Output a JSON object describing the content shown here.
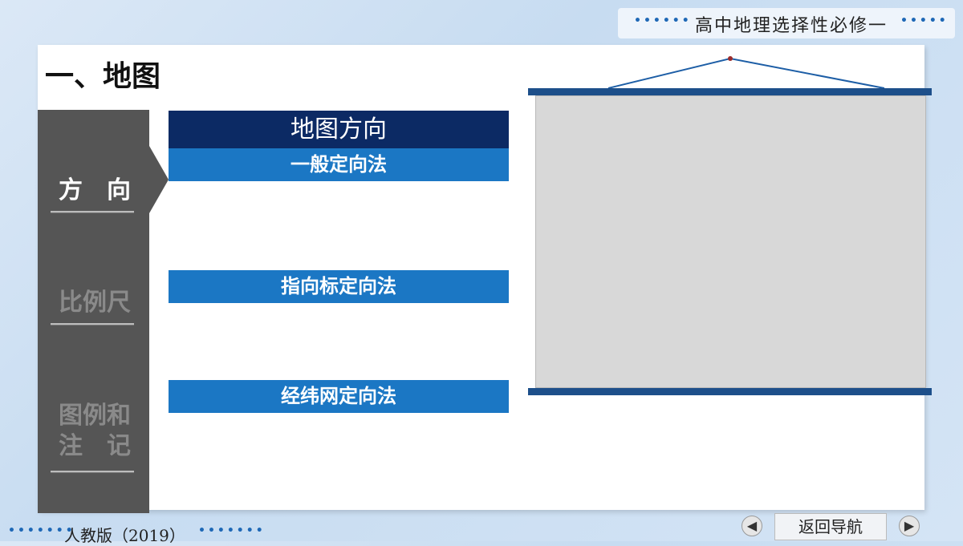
{
  "header": {
    "subject_title": "高中地理选择性必修一"
  },
  "section_title": "一、地图",
  "sidebar": {
    "items": [
      {
        "label": "方　向",
        "active": true
      },
      {
        "label": "比例尺",
        "active": false
      },
      {
        "label": "图例和注　记",
        "active": false
      }
    ]
  },
  "content": {
    "heading": "地图方向",
    "methods": [
      "一般定向法",
      "指向标定向法",
      "经纬网定向法"
    ]
  },
  "footer": {
    "edition": "人教版（2019）",
    "nav_label": "返回导航",
    "prev_icon": "arrow-left-icon",
    "next_icon": "arrow-right-icon"
  },
  "colors": {
    "accent": "#1b77c4",
    "header": "#0c2a64",
    "sidebar": "#555555"
  }
}
